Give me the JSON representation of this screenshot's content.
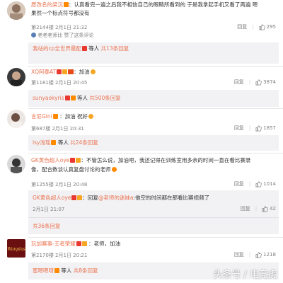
{
  "comments": [
    {
      "username": "愿改名的梁沅",
      "text": "：认真看完一遍之后我不相信自己的眼睛所看到的 于是我拿起手机又看了两遍 嗯",
      "text2": "果然一个标点符号都没有",
      "date": "第2144楼 2月1日 21:32",
      "reply": "回复",
      "likes": "295",
      "author_note": "老老老师比 赞了这条评论",
      "sub_text": "我站的cp全世界最配",
      "sub_etc": "等人",
      "sub_more": "共13条回复"
    },
    {
      "username": "XQ阿泰AT",
      "text": "：加油",
      "date": "第1181楼 2月1日 20:45",
      "reply": "回复",
      "likes": "3874",
      "sub_user": "sunyaokyris",
      "sub_etc": "等人",
      "sub_more": "共500条回复"
    },
    {
      "username": "言尼Gini",
      "text": "：加油 祝好",
      "date": "第687楼 2月1日 20:31",
      "reply": "回复",
      "likes": "1857",
      "sub_user": "lsy浅瑶",
      "sub_etc": "等人",
      "sub_more": "共24条回复"
    },
    {
      "username": "GK黄色超人oye",
      "text": "：不管怎么说，加油吧，我还记得在训练室用多余的时间一直在看比赛录",
      "text2": "像，配合数谈认真复盘讨论的老师",
      "date": "第1255楼 2月1日 20:48",
      "reply": "回复",
      "likes": "1014",
      "sub_user": "GK黄色超人oye",
      "sub_reply_label": "：回复",
      "sub_reply_target": "@老师的迷妹a",
      "sub_reply_text": ":他空的时间都在那看比赛视频了",
      "sub_date": "2月1日 21:07",
      "sub_reply": "回复",
      "sub_likes": "42",
      "sub_more": "共36条回复"
    },
    {
      "username": "玩加赛事-王者荣耀",
      "text": "：老师，加油",
      "date": "第2170楼 2月1日 20:21",
      "reply": "回复",
      "likes": "1218",
      "sub_user": "蜜嗯嗯呀",
      "sub_etc": "等人",
      "sub_more": "共8条回复"
    }
  ],
  "watermark": "头条号 / 电竞虎",
  "colors": {
    "username": "#eb7350",
    "meta": "#808080",
    "subbox": "#f2f2f5"
  }
}
